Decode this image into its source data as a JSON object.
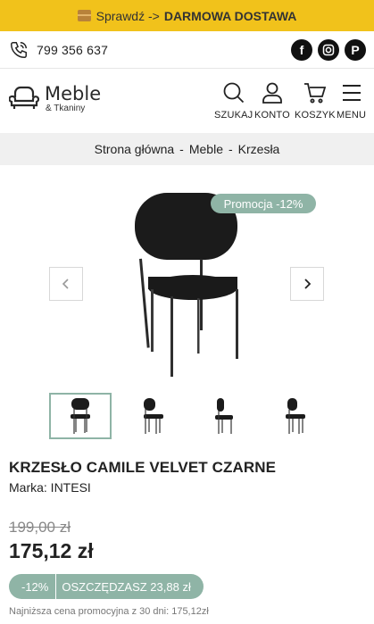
{
  "promo_bar": {
    "text": "Sprawdź ->",
    "highlight": "DARMOWA DOSTAWA",
    "icon": "package-icon"
  },
  "contact": {
    "phone": "799 356 637",
    "socials": [
      "facebook-icon",
      "instagram-icon",
      "pinterest-icon"
    ]
  },
  "header": {
    "logo_name": "Meble",
    "logo_sub": "& Tkaniny",
    "nav": [
      {
        "label": "SZUKAJ",
        "icon": "search-icon"
      },
      {
        "label": "KONTO",
        "icon": "user-icon"
      },
      {
        "label": "KOSZYK",
        "icon": "cart-icon"
      },
      {
        "label": "MENU",
        "icon": "hamburger-icon"
      }
    ]
  },
  "breadcrumb": {
    "items": [
      "Strona główna",
      "Meble",
      "Krzesła"
    ],
    "separator": "-"
  },
  "gallery": {
    "badge": "Promocja -12%",
    "thumbnail_count": 4,
    "active_thumbnail": 0
  },
  "product": {
    "title": "KRZESŁO CAMILE VELVET CZARNE",
    "brand": "Marka: INTESI",
    "old_price": "199,00 zł",
    "price": "175,12 zł",
    "discount_pct": "-12%",
    "savings": "OSZCZĘDZASZ 23,88 zł",
    "lowest_price_note": "Najniższa cena promocyjna z 30 dni: 175,12zł"
  },
  "colors": {
    "accent_yellow": "#f1c21b",
    "accent_green": "#8fb4a6",
    "breadcrumb_bg": "#f0f0f0"
  }
}
